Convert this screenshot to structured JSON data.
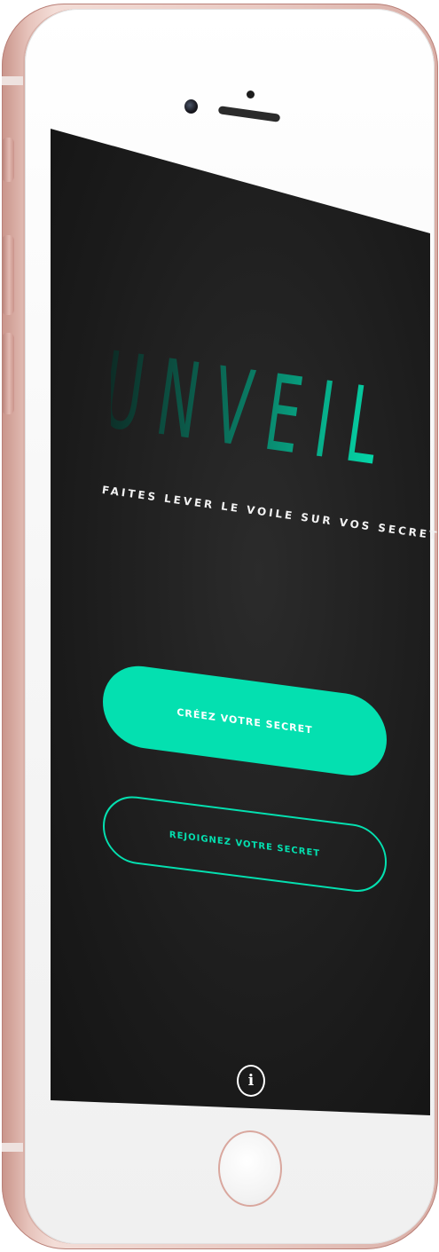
{
  "app": {
    "logo_text": "UNVEIL",
    "tagline": "FAITES LEVER LE VOILE SUR VOS SECRETS"
  },
  "actions": {
    "create_label": "CRÉEZ VOTRE SECRET",
    "join_label": "REJOIGNEZ VOTRE SECRET"
  },
  "footer": {
    "info_icon": "info-icon",
    "info_glyph": "i"
  },
  "colors": {
    "accent": "#04e0b0",
    "background": "#1e1e1e",
    "logo_gradient_start": "#0d2a24",
    "logo_gradient_end": "#04e0b0",
    "text": "#f2f2f2",
    "phone_frame": "#e6c2ba"
  }
}
